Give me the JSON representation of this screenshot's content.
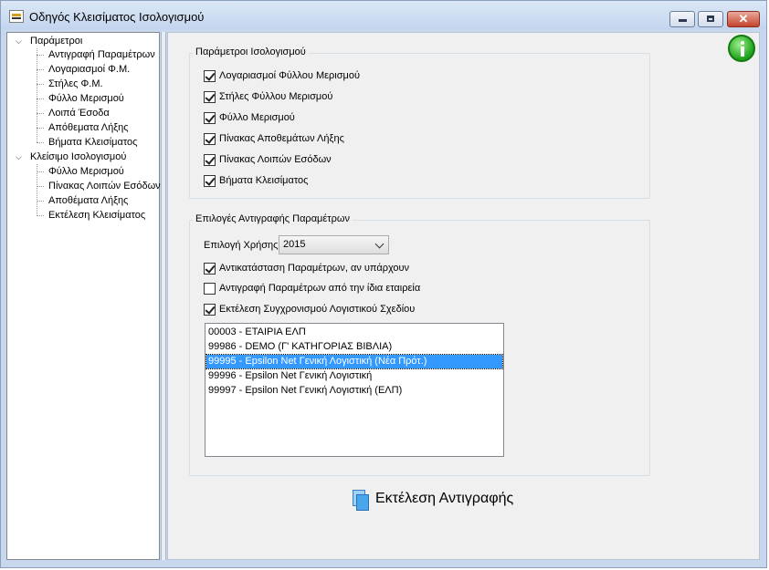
{
  "window": {
    "title": "Οδηγός Κλεισίματος Ισολογισμού",
    "controls": {
      "minimize": "minimize",
      "maximize": "maximize",
      "close": "close"
    }
  },
  "tree": {
    "groups": [
      {
        "label": "Παράμετροι",
        "children": [
          "Αντιγραφή Παραμέτρων",
          "Λογαριασμοί Φ.Μ.",
          "Στήλες Φ.Μ.",
          "Φύλλο Μερισμού",
          "Λοιπά Έσοδα",
          "Απόθεματα Λήξης",
          "Βήματα Κλεισίματος"
        ]
      },
      {
        "label": "Κλείσιμο Ισολογισμού",
        "children": [
          "Φύλλο Μερισμού",
          "Πίνακας Λοιπών Εσόδων",
          "Αποθέματα Λήξης",
          "Εκτέλεση Κλεισίματος"
        ]
      }
    ]
  },
  "params": {
    "group_label": "Παράμετροι Ισολογισμού",
    "items": [
      {
        "label": "Λογαριασμοί Φύλλου Μερισμού",
        "checked": true
      },
      {
        "label": "Στήλες Φύλλου Μερισμού",
        "checked": true
      },
      {
        "label": "Φύλλο Μερισμού",
        "checked": true
      },
      {
        "label": "Πίνακας Αποθεμάτων Λήξης",
        "checked": true
      },
      {
        "label": "Πίνακας Λοιπών Εσόδων",
        "checked": true
      },
      {
        "label": "Βήματα Κλεισίματος",
        "checked": true
      }
    ]
  },
  "copy": {
    "group_label": "Επιλογές Αντιγραφής Παραμέτρων",
    "year_label": "Επιλογή Χρήσης",
    "year_value": "2015",
    "options": [
      {
        "label": "Αντικατάσταση Παραμέτρων, αν υπάρχουν",
        "checked": true
      },
      {
        "label": "Αντιγραφή Παραμέτρων από την ίδια εταιρεία",
        "checked": false
      },
      {
        "label": "Εκτέλεση Συγχρονισμού Λογιστικού Σχεδίου",
        "checked": true
      }
    ],
    "companies": [
      "00003 - ΕΤΑΙΡΙΑ ΕΛΠ",
      "99986 - DEMO  (Γ' ΚΑΤΗΓΟΡΙΑΣ ΒΙΒΛΙΑ)",
      "99995 - Epsilon Net Γενική Λογιστική (Νέα Πρότ.)",
      "99996 - Epsilon Net Γενική Λογιστική",
      "99997 - Epsilon Net Γενική Λογιστική (ΕΛΠ)"
    ],
    "selected_index": 2
  },
  "run_button": {
    "label": "Εκτέλεση Αντιγραφής",
    "icon": "copy-documents-icon"
  },
  "colors": {
    "selection": "#3399ff",
    "info": "#1da11a",
    "frame": "#c6d7ee"
  }
}
